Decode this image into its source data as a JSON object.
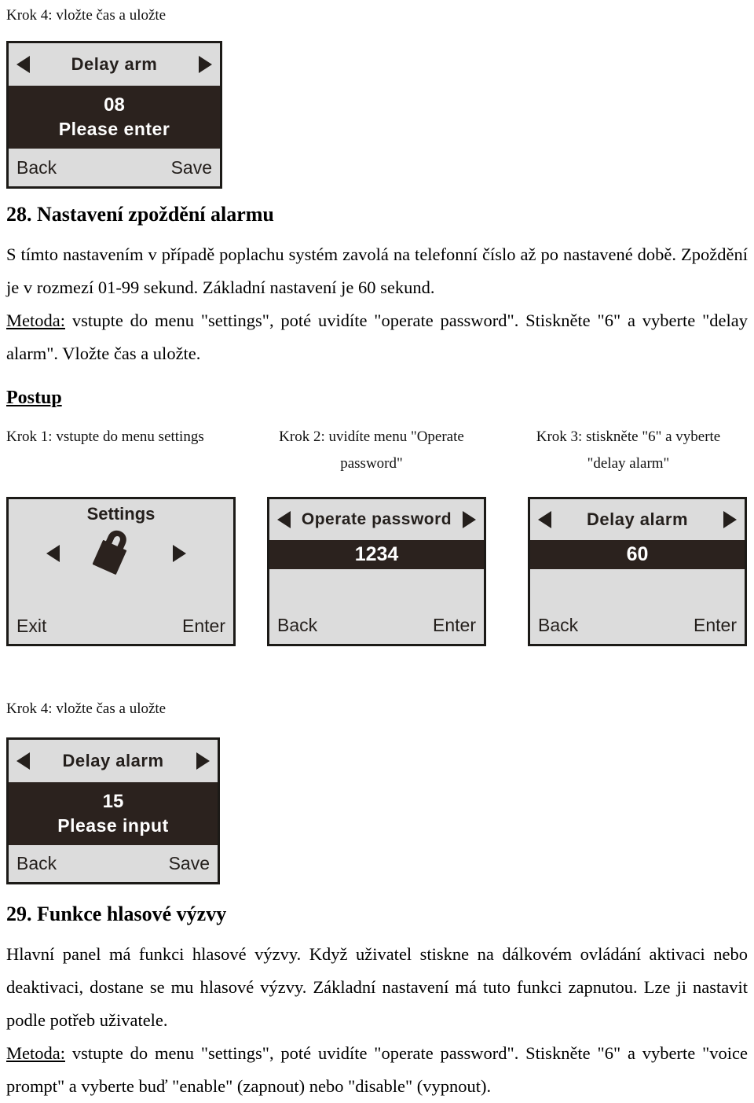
{
  "document": {
    "language": "cs",
    "top_caption": "Krok 4: vložte čas a uložte"
  },
  "section28": {
    "heading": "28. Nastavení zpoždění alarmu",
    "paragraph1": "S tímto nastavením v případě poplachu systém zavolá na telefonní číslo až po nastavené době. Zpoždění je v rozmezí 01-99 sekund. Základní nastavení je 60 sekund.",
    "method_label": "Metoda:",
    "method_text": " vstupte do menu \"settings\", poté uvidíte \"operate password\". Stiskněte \"6\" a vyberte \"delay alarm\". Vložte čas a uložte.",
    "procedure_heading": "Postup",
    "steps": [
      {
        "line1": "Krok 1: vstupte do menu settings",
        "line2": ""
      },
      {
        "line1": "Krok 2: uvidíte menu \"Operate",
        "line2": "password\""
      },
      {
        "line1": "Krok 3: stiskněte \"6\" a vyberte",
        "line2": "\"delay alarm\""
      }
    ],
    "step4_caption": "Krok 4: vložte čas a uložte"
  },
  "section29": {
    "heading": "29. Funkce hlasové výzvy",
    "paragraph1": "Hlavní panel má funkci hlasové výzvy. Když uživatel stiskne na dálkovém ovládání aktivaci nebo deaktivaci, dostane se mu hlasové výzvy. Základní nastavení má tuto funkci zapnutou. Lze ji nastavit podle potřeb uživatele.",
    "method_label": "Metoda:",
    "method_text": " vstupte do menu \"settings\", poté uvidíte \"operate password\". Stiskněte \"6\" a vyberte \"voice prompt\" a vyberte buď \"enable\" (zapnout) nebo \"disable\" (vypnout)."
  },
  "lcd_panels": {
    "panel_delay_arm": {
      "title": "Delay  arm",
      "value": "08",
      "prompt": "Please  enter",
      "left_button": "Back",
      "right_button": "Save",
      "left_arrow": "arrow-left-icon",
      "right_arrow": "arrow-right-icon"
    },
    "panel_settings": {
      "title": "Settings",
      "icon": "padlock-icon",
      "left_button": "Exit",
      "right_button": "Enter",
      "left_arrow": "arrow-left-icon",
      "right_arrow": "arrow-right-icon"
    },
    "panel_operate_password": {
      "title": "Operate password",
      "value": "1234",
      "prompt": "",
      "left_button": "Back",
      "right_button": "Enter",
      "left_arrow": "arrow-left-icon",
      "right_arrow": "arrow-right-icon"
    },
    "panel_delay_alarm": {
      "title": "Delay  alarm",
      "value": "60",
      "prompt": "",
      "left_button": "Back",
      "right_button": "Enter",
      "left_arrow": "arrow-left-icon",
      "right_arrow": "arrow-right-icon"
    },
    "panel_delay_alarm_input": {
      "title": "Delay  alarm",
      "value": "15",
      "prompt": "Please  input",
      "left_button": "Back",
      "right_button": "Save",
      "left_arrow": "arrow-left-icon",
      "right_arrow": "arrow-right-icon"
    }
  },
  "colors": {
    "lcd_background": "#dcdcdc",
    "lcd_dark_band": "#2b221e",
    "lcd_border": "#1c1a17",
    "text": "#000000"
  }
}
